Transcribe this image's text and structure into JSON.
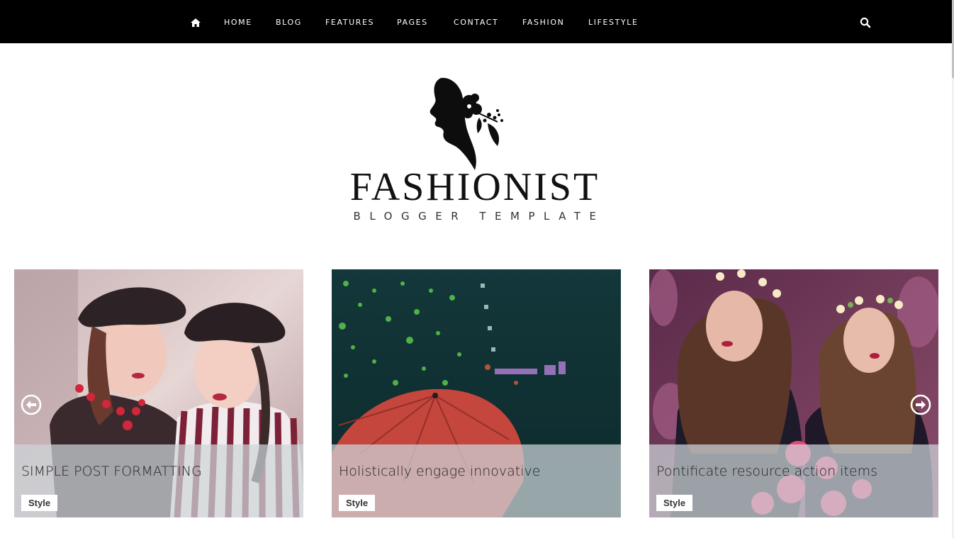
{
  "nav": {
    "home_icon": "home-icon",
    "items": [
      "HOME",
      "BLOG",
      "FEATURES",
      "PAGES",
      "CONTACT",
      "FASHION",
      "LIFESTYLE"
    ],
    "search_icon": "search-icon"
  },
  "logo": {
    "title": "FASHIONIST",
    "subtitle": "BLOGGER TEMPLATE"
  },
  "slider": {
    "prev_icon": "arrow-left-circle-icon",
    "next_icon": "arrow-right-circle-icon",
    "posts": [
      {
        "title": "SIMPLE POST FORMATTING",
        "tag": "Style"
      },
      {
        "title": "Holistically engage innovative",
        "tag": "Style"
      },
      {
        "title": "Pontificate resource action items",
        "tag": "Style"
      }
    ]
  },
  "colors": {
    "nav_bg": "#000000",
    "nav_text": "#ffffff",
    "overlay": "#cdd6da"
  }
}
